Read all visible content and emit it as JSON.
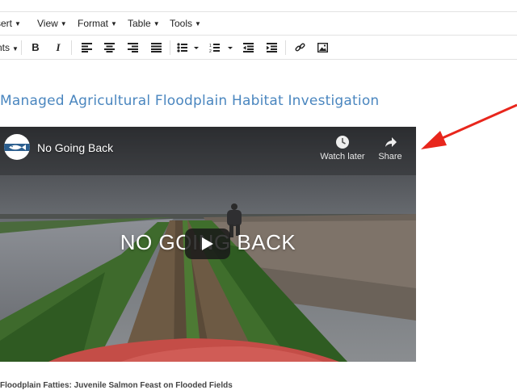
{
  "menubar": {
    "items": [
      {
        "label": "Insert"
      },
      {
        "label": "View"
      },
      {
        "label": "Format"
      },
      {
        "label": "Table"
      },
      {
        "label": "Tools"
      }
    ]
  },
  "toolbar": {
    "fonts_label": "Fonts",
    "bold_label": "B",
    "italic_label": "I"
  },
  "content": {
    "heading": "Managed Agricultural Floodplain Habitat Investigation",
    "caption": "Floodplain Fatties: Juvenile Salmon Feast on Flooded Fields"
  },
  "video": {
    "title": "No Going Back",
    "overlay_text": "NO GOING BACK",
    "watch_later_label": "Watch later",
    "share_label": "Share"
  },
  "colors": {
    "heading": "#4a86bf",
    "annotation_arrow": "#e8261c"
  }
}
